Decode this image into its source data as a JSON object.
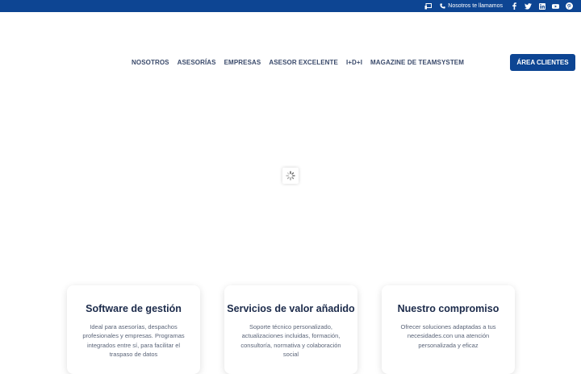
{
  "topbar": {
    "callback_label": "Nosotros te llamamos",
    "social": [
      "facebook-icon",
      "twitter-icon",
      "linkedin-icon",
      "youtube-icon",
      "pinterest-icon"
    ]
  },
  "nav": {
    "items": [
      {
        "label": "NOSOTROS"
      },
      {
        "label": "ASESORÍAS"
      },
      {
        "label": "EMPRESAS"
      },
      {
        "label": "ASESOR EXCELENTE"
      },
      {
        "label": "I+D+I"
      },
      {
        "label": "MAGAZINE DE TEAMSYSTEM"
      }
    ],
    "area_clientes": "ÁREA CLIENTES"
  },
  "cards": [
    {
      "title": "Software de gestión",
      "text": "Ideal para asesorías, despachos profesionales y empresas. Programas integrados entre sí, para facilitar el traspaso de datos"
    },
    {
      "title": "Servicios de valor añadido",
      "text": "Soporte técnico personalizado, actualizaciones incluidas, formación, consultoría, normativa y colaboración social"
    },
    {
      "title": "Nuestro compromiso",
      "text": "Ofrecer soluciones adaptadas a tus necesidades.con una atención personalizada y eficaz"
    }
  ],
  "colors": {
    "brand": "#0d4593",
    "nav_text": "#3a4a6b",
    "heading": "#1b2a4a",
    "body_text": "#5a6478"
  }
}
